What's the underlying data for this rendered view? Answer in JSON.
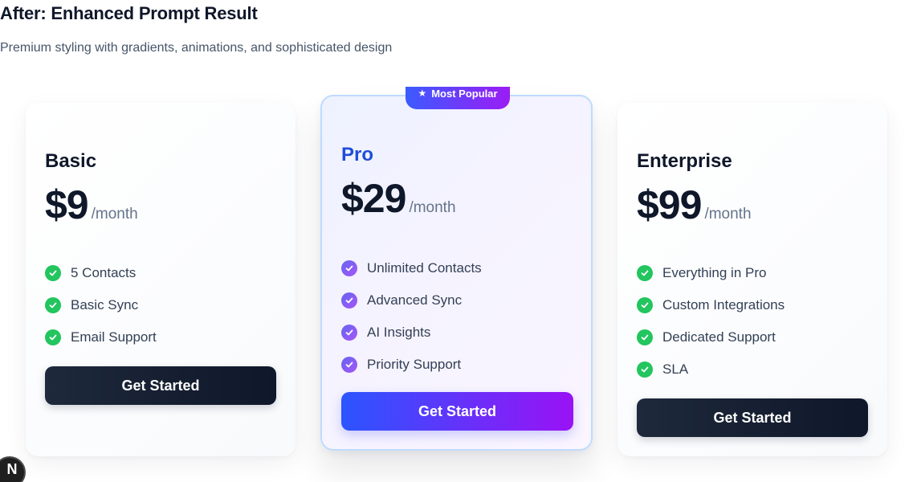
{
  "header": {
    "title": "After: Enhanced Prompt Result",
    "subtitle": "Premium styling with gradients, animations, and sophisticated design"
  },
  "plans": [
    {
      "name": "Basic",
      "price": "$9",
      "period": "/month",
      "features": [
        "5 Contacts",
        "Basic Sync",
        "Email Support"
      ],
      "cta": "Get Started"
    },
    {
      "name": "Pro",
      "badge": "Most Popular",
      "price": "$29",
      "period": "/month",
      "features": [
        "Unlimited Contacts",
        "Advanced Sync",
        "AI Insights",
        "Priority Support"
      ],
      "cta": "Get Started"
    },
    {
      "name": "Enterprise",
      "price": "$99",
      "period": "/month",
      "features": [
        "Everything in Pro",
        "Custom Integrations",
        "Dedicated Support",
        "SLA"
      ],
      "cta": "Get Started"
    }
  ],
  "dev_indicator": {
    "label": "N"
  },
  "icons": {
    "check": "check-circle-icon",
    "badge": "star-icon"
  },
  "colors": {
    "pro_accent": "#1d4ed8",
    "check_green": "#22c55e",
    "check_purple": "#8b5cf6",
    "cta_dark": "#0f172a",
    "cta_gradient_start": "#2b55ff",
    "cta_gradient_end": "#9a12f5"
  }
}
